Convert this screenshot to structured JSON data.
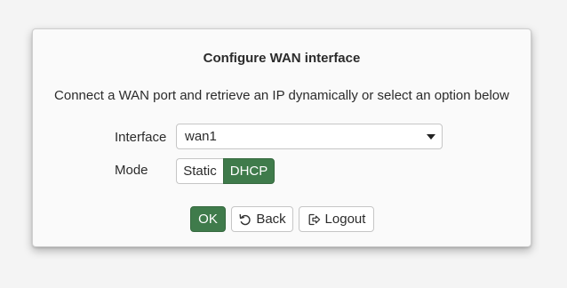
{
  "dialog": {
    "title": "Configure WAN interface",
    "description": "Connect a WAN port and retrieve an IP dynamically or select an option below"
  },
  "form": {
    "interface": {
      "label": "Interface",
      "value": "wan1"
    },
    "mode": {
      "label": "Mode",
      "options": [
        "Static",
        "DHCP"
      ],
      "selected": "DHCP"
    }
  },
  "actions": {
    "ok_label": "OK",
    "back_label": "Back",
    "back_icon": "undo-arrow-icon",
    "logout_label": "Logout",
    "logout_icon": "sign-out-icon"
  },
  "colors": {
    "accent": "#3f7b4b",
    "text": "#2b2b2b",
    "border": "#c6c6c6"
  }
}
